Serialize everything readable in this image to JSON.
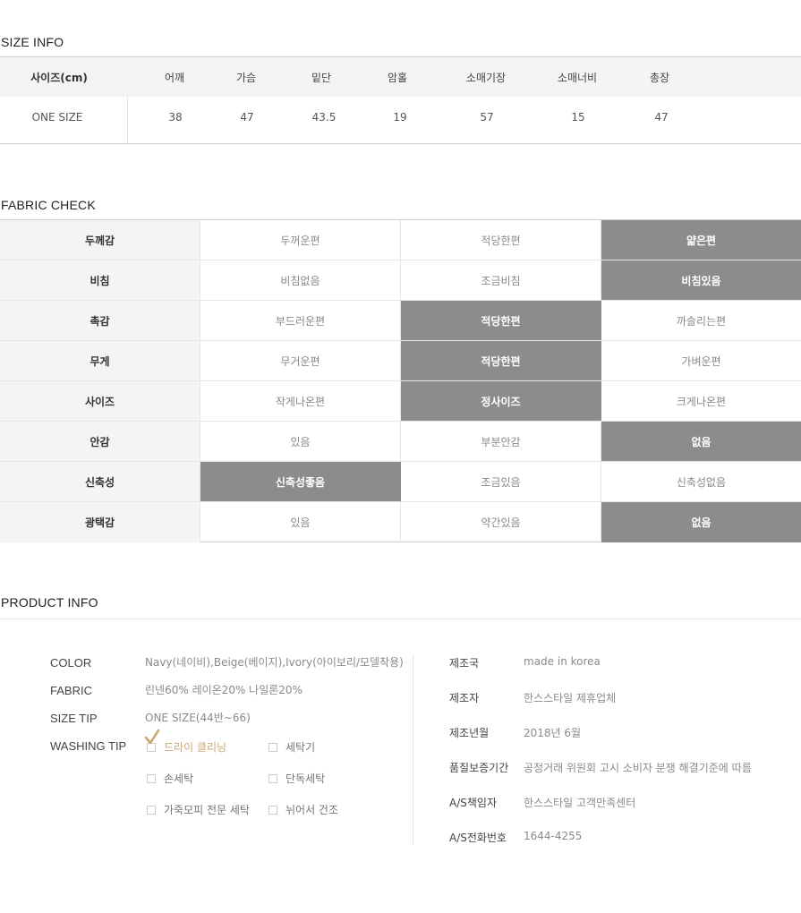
{
  "size_info": {
    "title": "SIZE INFO",
    "headers": [
      "사이즈(cm)",
      "어깨",
      "가슴",
      "밑단",
      "암홀",
      "소매기장",
      "소매너비",
      "총장"
    ],
    "rows": [
      [
        "ONE SIZE",
        "38",
        "47",
        "43.5",
        "19",
        "57",
        "15",
        "47"
      ]
    ]
  },
  "fabric_check": {
    "title": "FABRIC CHECK",
    "rows": [
      {
        "label": "두께감",
        "options": [
          "두꺼운편",
          "적당한편",
          "얇은편"
        ],
        "selected": 2
      },
      {
        "label": "비침",
        "options": [
          "비침없음",
          "조금비침",
          "비침있음"
        ],
        "selected": 2
      },
      {
        "label": "촉감",
        "options": [
          "부드러운편",
          "적당한편",
          "까슬리는편"
        ],
        "selected": 1
      },
      {
        "label": "무게",
        "options": [
          "무거운편",
          "적당한편",
          "가벼운편"
        ],
        "selected": 1
      },
      {
        "label": "사이즈",
        "options": [
          "작게나온편",
          "정사이즈",
          "크게나온편"
        ],
        "selected": 1
      },
      {
        "label": "안감",
        "options": [
          "있음",
          "부분안감",
          "없음"
        ],
        "selected": 2
      },
      {
        "label": "신축성",
        "options": [
          "신축성좋음",
          "조금있음",
          "신축성없음"
        ],
        "selected": 0
      },
      {
        "label": "광택감",
        "options": [
          "있음",
          "약간있음",
          "없음"
        ],
        "selected": 2
      }
    ]
  },
  "product_info": {
    "title": "PRODUCT INFO",
    "color_label": "COLOR",
    "color_value": "Navy(네이비),Beige(베이지),Ivory(아이보리/모델착용)",
    "fabric_label": "FABRIC",
    "fabric_value": "린넨60% 레이온20% 나일론20%",
    "size_tip_label": "SIZE TIP",
    "size_tip_value": "ONE SIZE(44반~66)",
    "washing_tip_label": "WASHING TIP",
    "washing_options": [
      {
        "label": "드라이 클리닝",
        "checked": true
      },
      {
        "label": "세탁기",
        "checked": false
      },
      {
        "label": "손세탁",
        "checked": false
      },
      {
        "label": "단독세탁",
        "checked": false
      },
      {
        "label": "가죽모피 전문 세탁",
        "checked": false
      },
      {
        "label": "뉘어서 건조",
        "checked": false
      }
    ],
    "details": [
      {
        "label": "제조국",
        "value": "made in korea"
      },
      {
        "label": "제조자",
        "value": "한스스타일 제휴업체"
      },
      {
        "label": "제조년월",
        "value": "2018년 6월"
      },
      {
        "label": "품질보증기간",
        "value": "공정거래 위원회 고시 소비자 분쟁 해결기준에 따름"
      },
      {
        "label": "A/S책임자",
        "value": "한스스타일 고객만족센터"
      },
      {
        "label": "A/S전화번호",
        "value": "1644-4255"
      }
    ],
    "accent_color": "#c9a77a",
    "selected_color": "#8c8c8c"
  }
}
